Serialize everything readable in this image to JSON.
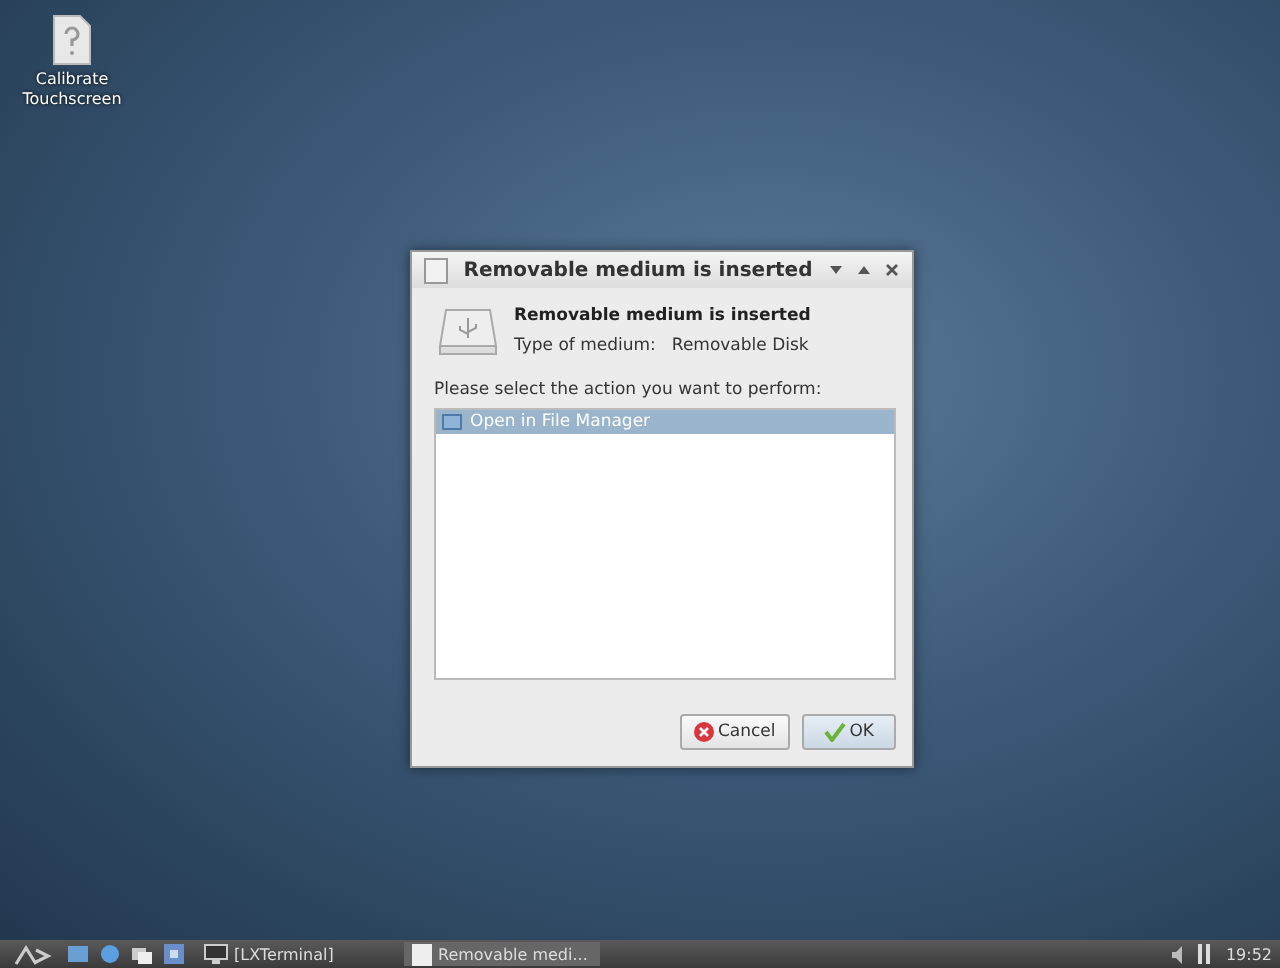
{
  "desktop_icons": [
    {
      "label": "Calibrate Touchscreen"
    }
  ],
  "dialog": {
    "title": "Removable medium is inserted",
    "heading": "Removable medium is inserted",
    "medium_label": "Type of medium:",
    "medium_value": "Removable Disk",
    "prompt": "Please select the action you want to perform:",
    "actions": [
      {
        "label": "Open in File Manager",
        "selected": true
      }
    ],
    "buttons": [
      {
        "label": "Cancel",
        "kind": "cancel"
      },
      {
        "label": "OK",
        "kind": "ok"
      }
    ]
  },
  "taskbar": {
    "tasks": [
      {
        "label": "[LXTerminal]",
        "kind": "terminal",
        "selected": false
      },
      {
        "label": "Removable medi...",
        "kind": "dialog",
        "selected": true
      }
    ],
    "clock": "19:52"
  }
}
